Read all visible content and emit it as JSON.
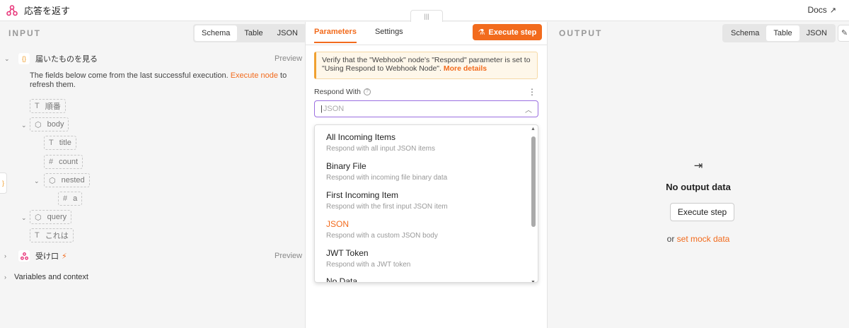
{
  "window": {
    "title": "応答を返す",
    "docs_label": "Docs",
    "drag_handle": "|||"
  },
  "input": {
    "label": "INPUT",
    "view_tabs": [
      "Schema",
      "Table",
      "JSON"
    ],
    "active_view": "Schema",
    "node1": {
      "name": "届いたものを見る",
      "preview": "Preview",
      "desc_before": "The fields below come from the last successful execution. ",
      "desc_link": "Execute node",
      "desc_after": " to refresh them."
    },
    "fields": [
      {
        "type": "T",
        "name": "順番"
      },
      {
        "type": "⬡",
        "name": "body"
      },
      {
        "type": "T",
        "name": "title"
      },
      {
        "type": "#",
        "name": "count"
      },
      {
        "type": "⬡",
        "name": "nested"
      },
      {
        "type": "#",
        "name": "a"
      },
      {
        "type": "⬡",
        "name": "query"
      },
      {
        "type": "T",
        "name": "これは"
      }
    ],
    "node2": {
      "name": "受け口",
      "preview": "Preview"
    },
    "variables": "Variables and context"
  },
  "params": {
    "tabs": [
      "Parameters",
      "Settings"
    ],
    "active_tab": "Parameters",
    "execute_label": "Execute step",
    "notice_text": "Verify that the \"Webhook\" node's \"Respond\" parameter is set to \"Using Respond to Webhook Node\". ",
    "notice_link": "More details",
    "field_label": "Respond With",
    "select_value": "JSON",
    "options": [
      {
        "label": "All Incoming Items",
        "desc": "Respond with all input JSON items"
      },
      {
        "label": "Binary File",
        "desc": "Respond with incoming file binary data"
      },
      {
        "label": "First Incoming Item",
        "desc": "Respond with the first input JSON item"
      },
      {
        "label": "JSON",
        "desc": "Respond with a custom JSON body"
      },
      {
        "label": "JWT Token",
        "desc": "Respond with a JWT token"
      },
      {
        "label": "No Data",
        "desc": ""
      }
    ],
    "selected_option": "JSON"
  },
  "output": {
    "label": "OUTPUT",
    "view_tabs": [
      "Schema",
      "Table",
      "JSON"
    ],
    "active_view": "Table",
    "empty_title": "No output data",
    "execute_label": "Execute step",
    "or_text": "or ",
    "mock_link": "set mock data"
  },
  "colors": {
    "accent": "#f26b1d",
    "logo": "#e8367a",
    "select_border": "#9b6fe0"
  }
}
